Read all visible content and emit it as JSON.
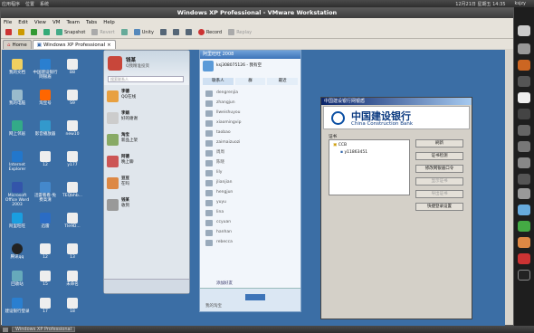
{
  "top_panel": {
    "menus": [
      "应用程序",
      "位置",
      "系统"
    ],
    "clock": "12月21日 星期五 14:35",
    "user": "ksjzy"
  },
  "vmware": {
    "title": "Windows XP Professional - VMware Workstation",
    "menu": [
      "File",
      "Edit",
      "View",
      "VM",
      "Team",
      "Tabs",
      "Help"
    ],
    "toolbar": {
      "snapshot": "Snapshot",
      "revert": "Revert",
      "unity": "Unity",
      "record": "Record",
      "replay": "Replay"
    },
    "tabs": [
      {
        "label": "Home"
      },
      {
        "label": "Windows XP Professional"
      }
    ]
  },
  "desktop_icons": [
    {
      "label": "我的文档"
    },
    {
      "label": "中国建设银行网银盾"
    },
    {
      "label": "B8"
    },
    {
      "label": "我的电脑"
    },
    {
      "label": "淘宝号"
    },
    {
      "label": "S9"
    },
    {
      "label": "网上邻居"
    },
    {
      "label": "影音播放器"
    },
    {
      "label": "new10"
    },
    {
      "label": "Internet Explorer"
    },
    {
      "label": "12"
    },
    {
      "label": "y177"
    },
    {
      "label": "Microsoft Office Word 2003"
    },
    {
      "label": "迅雷看看-免费高清"
    },
    {
      "label": "TEQbhb..."
    },
    {
      "label": "阿里旺旺"
    },
    {
      "label": "迅雷"
    },
    {
      "label": "Tle9D..."
    },
    {
      "label": "腾讯qq"
    },
    {
      "label": "12"
    },
    {
      "label": "13"
    },
    {
      "label": "回收站"
    },
    {
      "label": "15"
    },
    {
      "label": "未命名"
    },
    {
      "label": "建设银行登录"
    },
    {
      "label": "17"
    },
    {
      "label": "18"
    }
  ],
  "qq_window": {
    "nickname": "钱某",
    "status": "Q我精准投资",
    "search_placeholder": "搜索联系人",
    "items": [
      {
        "name": "李德",
        "msg": "QQ在线"
      },
      {
        "name": "李娟",
        "msg": "好的谢谢"
      },
      {
        "name": "淘宝",
        "msg": "新品上架"
      },
      {
        "name": "阿德",
        "msg": "晚上聊"
      },
      {
        "name": "豆豆",
        "msg": "在吗"
      },
      {
        "name": "钱某",
        "msg": "收到"
      }
    ]
  },
  "msn_window": {
    "title": "阿里旺旺 2008",
    "account": "ksj308075126 - 我有空",
    "tabs": [
      "联系人",
      "群",
      "最近"
    ],
    "rows": [
      "dengrenjia",
      "zhangjun",
      "llweishuyou",
      "xiaomingvip",
      "taobao",
      "zaimaizuozi",
      "周周",
      "陈晓",
      "lily",
      "jlianjian",
      "hengjun",
      "yuyu",
      "lina",
      "ccyuan",
      "hanhan",
      "rebecca"
    ],
    "add_label": "添加好友",
    "bottom_label": "我的淘宝"
  },
  "ccb_window": {
    "title": "中国建设银行网银盾",
    "bank_cn": "中国建设银行",
    "bank_en": "China Construction Bank",
    "cert_label": "证书",
    "tree_root": "CCB",
    "tree_child": "y11863451",
    "buttons": [
      "刷新",
      "证书检测",
      "修改网银盾口令",
      "显示证书",
      "导出证书",
      "快捷登录设置"
    ]
  },
  "taskbar": {
    "item": "Windows XP Professional"
  }
}
